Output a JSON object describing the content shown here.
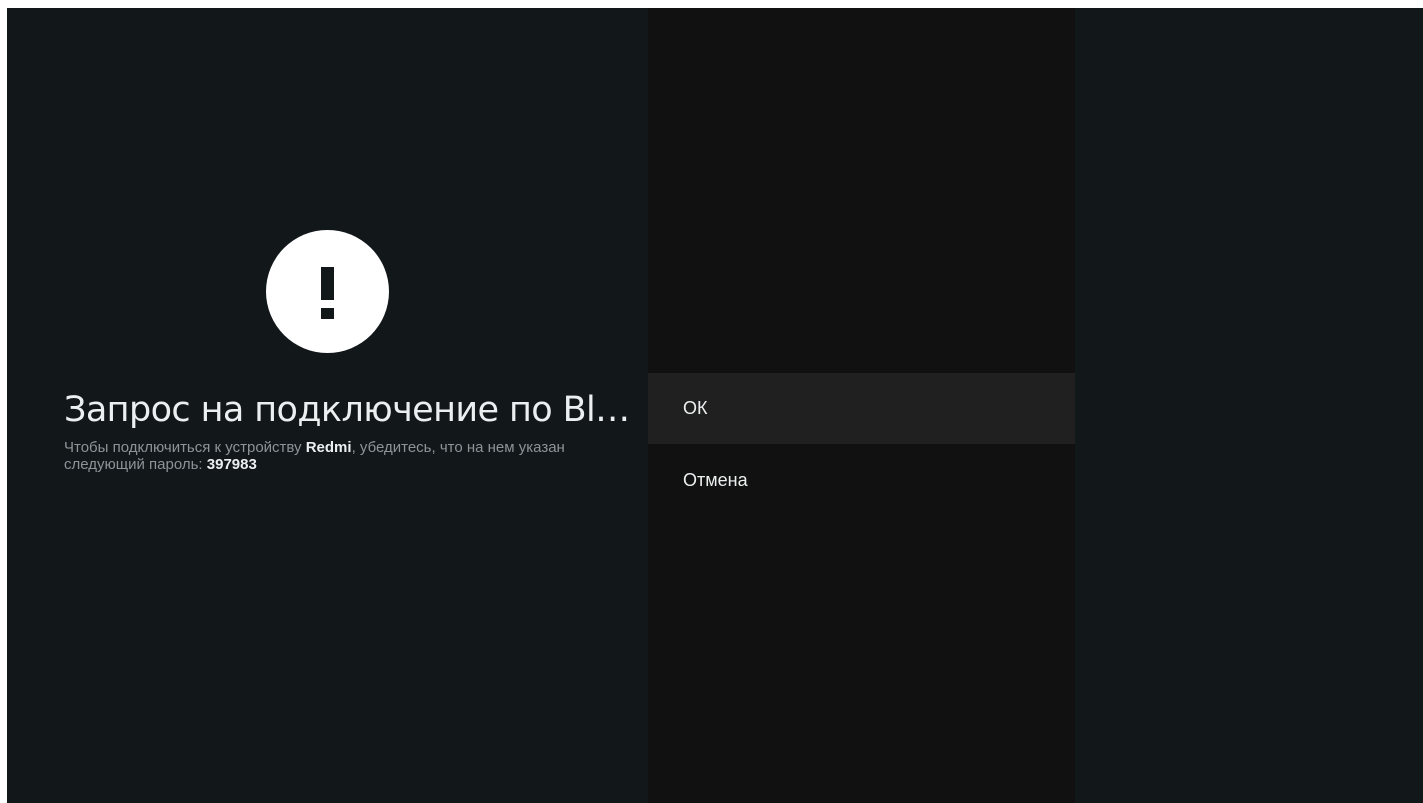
{
  "dialog": {
    "icon": "alert-exclamation-icon",
    "title": "Запрос на подключение по Bluetooth",
    "description": {
      "part1": "Чтобы подключиться к устройству ",
      "device_name": "Redmi",
      "part2": ", убедитесь, что на нем указан следующий пароль: ",
      "passkey": "397983"
    }
  },
  "actions": {
    "ok_label": "ОК",
    "cancel_label": "Отмена",
    "focused": "ok"
  },
  "colors": {
    "background": "#12171a",
    "actions_panel": "#111111",
    "focused_item": "#202020",
    "icon": "#ffffff"
  }
}
